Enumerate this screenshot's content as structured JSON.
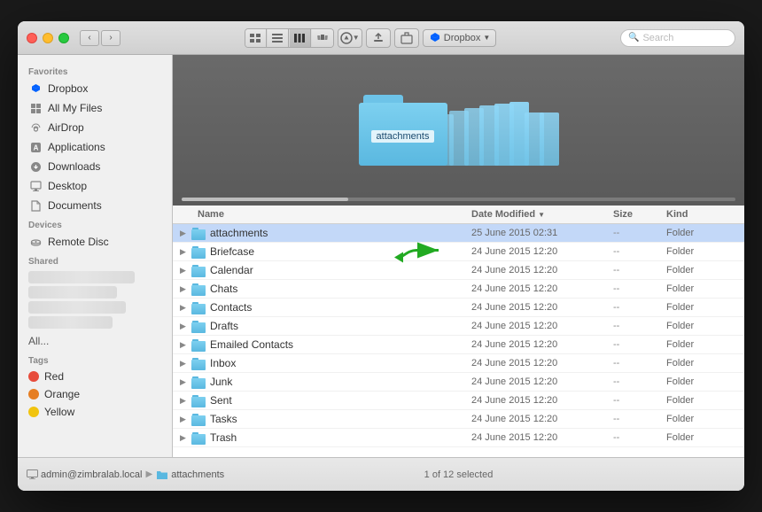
{
  "window": {
    "title": "attachments"
  },
  "toolbar": {
    "back_label": "‹",
    "forward_label": "›",
    "views": [
      "icon",
      "list",
      "column",
      "cover"
    ],
    "active_view": "column",
    "action_label": "⚙",
    "upload_label": "↑",
    "share_label": "⇧",
    "dropbox_label": "Dropbox",
    "search_placeholder": "Search"
  },
  "sidebar": {
    "favorites_label": "Favorites",
    "items": [
      {
        "id": "dropbox",
        "label": "Dropbox",
        "icon": "📦"
      },
      {
        "id": "all-files",
        "label": "All My Files",
        "icon": "⊞"
      },
      {
        "id": "airdrop",
        "label": "AirDrop",
        "icon": "📡"
      },
      {
        "id": "applications",
        "label": "Applications",
        "icon": "🅰"
      },
      {
        "id": "downloads",
        "label": "Downloads",
        "icon": "⬇"
      },
      {
        "id": "desktop",
        "label": "Desktop",
        "icon": "🖥"
      },
      {
        "id": "documents",
        "label": "Documents",
        "icon": "📄"
      }
    ],
    "devices_label": "Devices",
    "devices": [
      {
        "id": "remote-disc",
        "label": "Remote Disc",
        "icon": "💿"
      }
    ],
    "shared_label": "Shared",
    "shared_blurred": true,
    "all_label": "All...",
    "tags_label": "Tags",
    "tags": [
      {
        "id": "red",
        "label": "Red",
        "color": "#e74c3c"
      },
      {
        "id": "orange",
        "label": "Orange",
        "color": "#e67e22"
      },
      {
        "id": "yellow",
        "label": "Yellow",
        "color": "#f1c40f"
      }
    ]
  },
  "preview": {
    "folder_label": "attachments"
  },
  "file_list": {
    "columns": {
      "name": "Name",
      "modified": "Date Modified",
      "size": "Size",
      "kind": "Kind"
    },
    "rows": [
      {
        "name": "attachments",
        "modified": "25 June 2015 02:31",
        "size": "--",
        "kind": "Folder",
        "selected": true
      },
      {
        "name": "Briefcase",
        "modified": "24 June 2015 12:20",
        "size": "--",
        "kind": "Folder",
        "selected": false,
        "highlighted": true
      },
      {
        "name": "Calendar",
        "modified": "24 June 2015 12:20",
        "size": "--",
        "kind": "Folder",
        "selected": false
      },
      {
        "name": "Chats",
        "modified": "24 June 2015 12:20",
        "size": "--",
        "kind": "Folder",
        "selected": false
      },
      {
        "name": "Contacts",
        "modified": "24 June 2015 12:20",
        "size": "--",
        "kind": "Folder",
        "selected": false
      },
      {
        "name": "Drafts",
        "modified": "24 June 2015 12:20",
        "size": "--",
        "kind": "Folder",
        "selected": false
      },
      {
        "name": "Emailed Contacts",
        "modified": "24 June 2015 12:20",
        "size": "--",
        "kind": "Folder",
        "selected": false
      },
      {
        "name": "Inbox",
        "modified": "24 June 2015 12:20",
        "size": "--",
        "kind": "Folder",
        "selected": false
      },
      {
        "name": "Junk",
        "modified": "24 June 2015 12:20",
        "size": "--",
        "kind": "Folder",
        "selected": false
      },
      {
        "name": "Sent",
        "modified": "24 June 2015 12:20",
        "size": "--",
        "kind": "Folder",
        "selected": false
      },
      {
        "name": "Tasks",
        "modified": "24 June 2015 12:20",
        "size": "--",
        "kind": "Folder",
        "selected": false
      },
      {
        "name": "Trash",
        "modified": "24 June 2015 12:20",
        "size": "--",
        "kind": "Folder",
        "selected": false
      }
    ]
  },
  "status_bar": {
    "breadcrumb": [
      {
        "label": "admin@zimbralab.local",
        "icon": "🖥"
      },
      {
        "separator": "▶"
      },
      {
        "label": "attachments",
        "icon": "📁"
      }
    ],
    "status_text": "1 of 12 selected"
  }
}
